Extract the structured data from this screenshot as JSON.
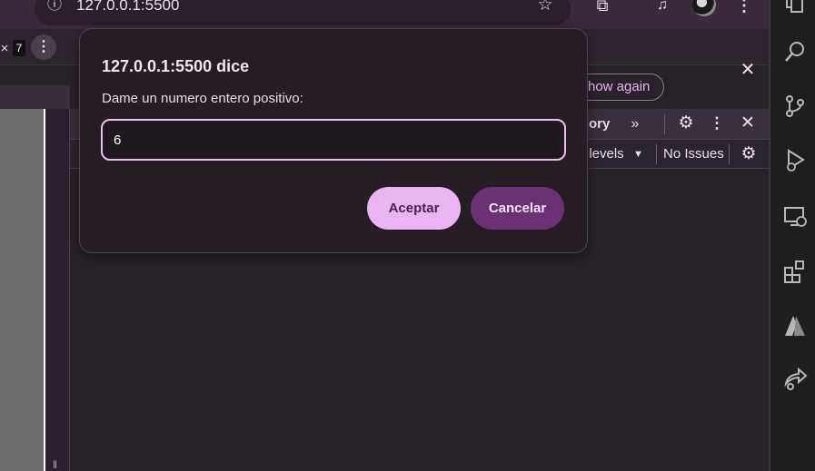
{
  "browser": {
    "url": "127.0.0.1:5500",
    "info_icon": "info-icon",
    "star_icon": "star-icon",
    "extensions_icon": "puzzle-icon",
    "media_icon": "media-control-icon",
    "menu_icon": "kebab-menu-icon"
  },
  "tabs": {
    "close_symbol": "×",
    "badge": "7",
    "kebab": "⋮"
  },
  "devtools": {
    "close_symbol": "✕",
    "dont_show_again_label": "how again",
    "tab_partial_label": "ory",
    "more_tabs_symbol": "»",
    "levels_label": "t levels",
    "levels_caret": "▼",
    "issues_label": "No Issues"
  },
  "dialog": {
    "title": "127.0.0.1:5500 dice",
    "message": "Dame un numero entero positivo:",
    "input_value": "6",
    "accept_label": "Aceptar",
    "cancel_label": "Cancelar"
  },
  "activity_bar": {
    "icons": [
      "explorer-icon",
      "search-icon",
      "source-control-icon",
      "run-debug-icon",
      "remote-explorer-icon",
      "extensions-icon",
      "azure-icon",
      "live-share-icon"
    ]
  },
  "colors": {
    "accent": "#eab3f2",
    "cancel_bg": "#6a3272",
    "dialog_bg": "#251c24"
  }
}
